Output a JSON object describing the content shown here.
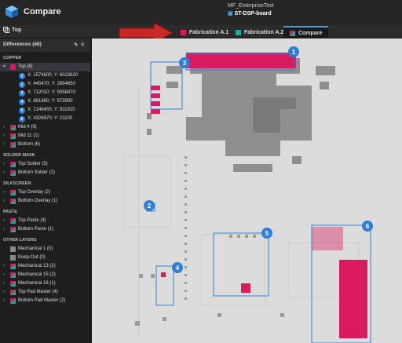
{
  "app": {
    "title": "Compare",
    "project": "MF_EnterpriseTest",
    "board": "ST-DSP-board"
  },
  "toolbar": {
    "top_label": "Top"
  },
  "tabs": [
    {
      "label": "Fabrication A.1",
      "color": "#d81b60"
    },
    {
      "label": "Fabrication A.2",
      "color": "#26a69a"
    },
    {
      "label": "Compare",
      "color": "#d81b60"
    }
  ],
  "sidebar": {
    "title": "Differences (48)",
    "sections": {
      "copper": "COPPER",
      "solder_mask": "SOLDER MASK",
      "silkscreen": "SILKSCREEN",
      "paste": "PASTE",
      "other": "OTHER LAYERS"
    },
    "top": "Top (6)",
    "diffs": [
      {
        "n": "1",
        "label": "X: 1574800; Y: 6023620"
      },
      {
        "n": "2",
        "label": "X: 445470; Y: 2884650"
      },
      {
        "n": "3",
        "label": "X: 712010; Y: 5058470"
      },
      {
        "n": "4",
        "label": "X: 861690; Y: 673900"
      },
      {
        "n": "5",
        "label": "X: 2146455; Y: 911915"
      },
      {
        "n": "6",
        "label": "X: 4326970; Y: 21100"
      }
    ],
    "mid4": "Mid 4 (9)",
    "mid11": "Mid 11 (1)",
    "bottom": "Bottom (6)",
    "top_solder": "Top Solder (5)",
    "bottom_solder": "Bottom Solder (2)",
    "top_overlay": "Top Overlay (2)",
    "bottom_overlay": "Bottom Overlay (1)",
    "top_paste": "Top Paste (4)",
    "bottom_paste": "Bottom Paste (1)",
    "mech1": "Mechanical 1 (0)",
    "keepout": "Keep-Out (0)",
    "mech13": "Mechanical 13 (2)",
    "mech15": "Mechanical 15 (2)",
    "mech16": "Mechanical 16 (1)",
    "top_pad": "Top Pad Master (4)",
    "bottom_pad": "Bottom Pad Master (2)"
  },
  "markers": [
    "1",
    "2",
    "3",
    "4",
    "5",
    "6"
  ],
  "colors": {
    "accent": "#2f7fd6",
    "diff": "#d81b60",
    "arrow": "#c62828"
  }
}
